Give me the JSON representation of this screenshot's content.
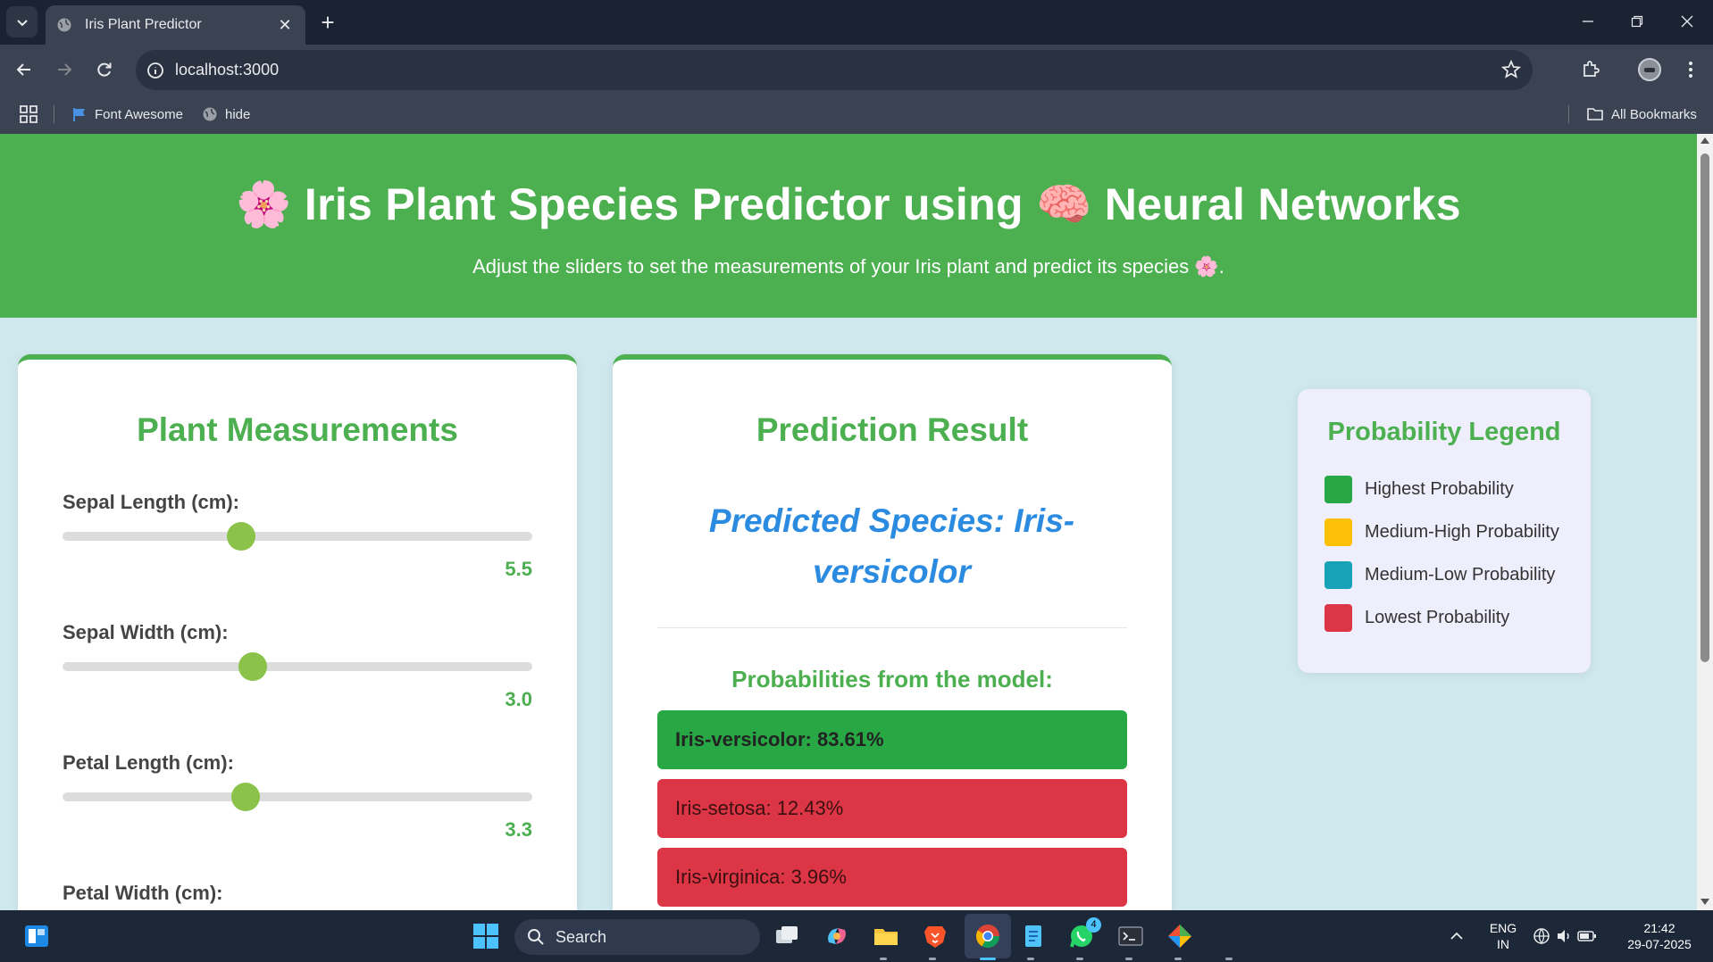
{
  "browser": {
    "tab_title": "Iris Plant Predictor",
    "url": "localhost:3000",
    "bookmarks": [
      "Font Awesome",
      "hide"
    ],
    "all_bookmarks": "All Bookmarks"
  },
  "header": {
    "title": "🌸 Iris Plant Species Predictor using 🧠 Neural Networks",
    "subtitle": "Adjust the sliders to set the measurements of your Iris plant and predict its species 🌸."
  },
  "measurements": {
    "title": "Plant Measurements",
    "fields": [
      {
        "label": "Sepal Length (cm):",
        "value": "5.5",
        "fraction": 0.38
      },
      {
        "label": "Sepal Width (cm):",
        "value": "3.0",
        "fraction": 0.405
      },
      {
        "label": "Petal Length (cm):",
        "value": "3.3",
        "fraction": 0.39
      },
      {
        "label": "Petal Width (cm):"
      }
    ]
  },
  "prediction": {
    "title": "Prediction Result",
    "predicted": "Predicted Species: Iris-versicolor",
    "probs_title": "Probabilities from the model:",
    "probabilities": [
      {
        "text": "Iris-versicolor: 83.61%",
        "level": "highest",
        "color": "#28a745"
      },
      {
        "text": "Iris-setosa: 12.43%",
        "level": "lowest",
        "color": "#dc3545"
      },
      {
        "text": "Iris-virginica: 3.96%",
        "level": "lowest",
        "color": "#dc3545"
      }
    ]
  },
  "legend": {
    "title": "Probability Legend",
    "items": [
      {
        "label": "Highest Probability",
        "color": "#28a745"
      },
      {
        "label": "Medium-High Probability",
        "color": "#ffc107"
      },
      {
        "label": "Medium-Low Probability",
        "color": "#17a2b8"
      },
      {
        "label": "Lowest Probability",
        "color": "#dc3545"
      }
    ]
  },
  "taskbar": {
    "search_placeholder": "Search",
    "language": "ENG",
    "region": "IN",
    "time": "21:42",
    "date": "29-07-2025",
    "whatsapp_badge": "4"
  },
  "colors": {
    "header_green": "#4caf50",
    "slider_thumb": "#8bc34a",
    "prediction_blue": "#2b8be0",
    "page_bg": "#cfe8ee"
  }
}
